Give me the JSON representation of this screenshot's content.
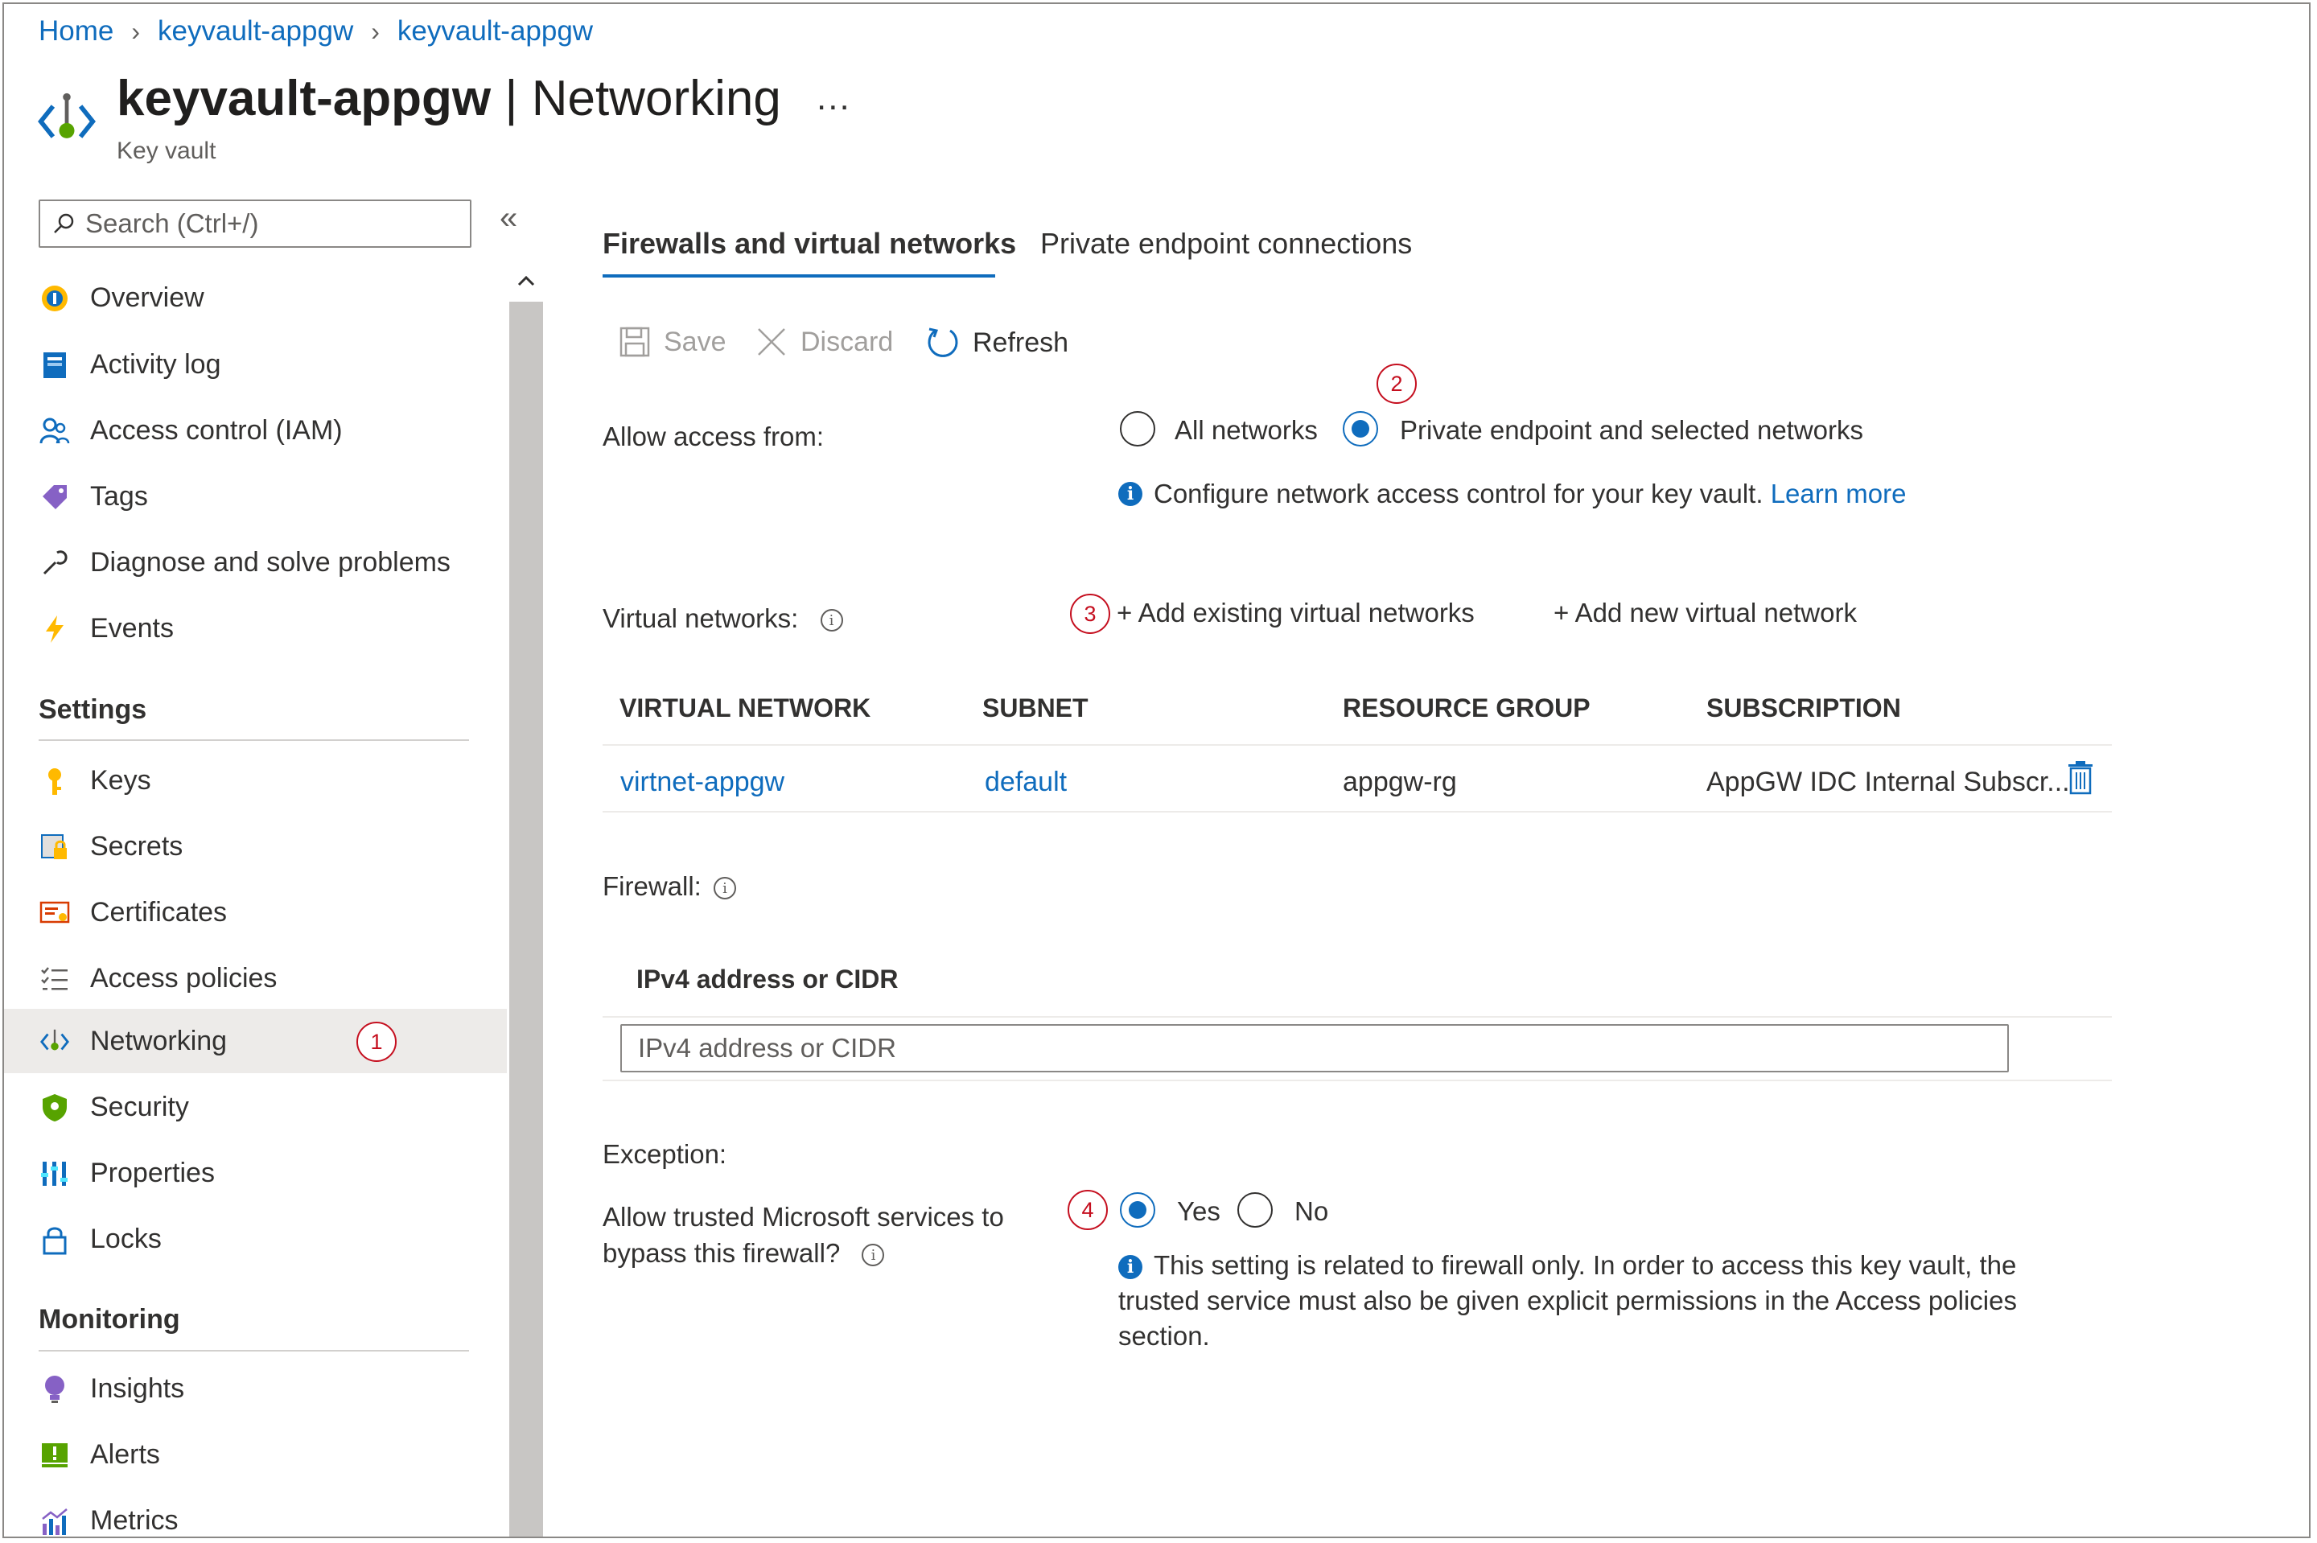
{
  "breadcrumb": {
    "items": [
      "Home",
      "keyvault-appgw",
      "keyvault-appgw"
    ]
  },
  "header": {
    "title_resource": "keyvault-appgw",
    "title_separator": "|",
    "title_page": "Networking",
    "more": "...",
    "subtitle": "Key vault",
    "icon": "networking-icon"
  },
  "sidebar": {
    "search_placeholder": "Search (Ctrl+/)",
    "collapse_label": "«",
    "items": [
      {
        "label": "Overview",
        "icon": "overview-icon"
      },
      {
        "label": "Activity log",
        "icon": "activity-log-icon"
      },
      {
        "label": "Access control (IAM)",
        "icon": "people-icon"
      },
      {
        "label": "Tags",
        "icon": "tag-icon"
      },
      {
        "label": "Diagnose and solve problems",
        "icon": "wrench-icon"
      },
      {
        "label": "Events",
        "icon": "lightning-icon"
      }
    ],
    "settings_title": "Settings",
    "settings_items": [
      {
        "label": "Keys",
        "icon": "key-icon"
      },
      {
        "label": "Secrets",
        "icon": "secret-icon"
      },
      {
        "label": "Certificates",
        "icon": "certificate-icon"
      },
      {
        "label": "Access policies",
        "icon": "checklist-icon"
      },
      {
        "label": "Networking",
        "icon": "networking-icon",
        "active": true
      },
      {
        "label": "Security",
        "icon": "shield-icon"
      },
      {
        "label": "Properties",
        "icon": "properties-icon"
      },
      {
        "label": "Locks",
        "icon": "lock-icon"
      }
    ],
    "monitoring_title": "Monitoring",
    "monitoring_items": [
      {
        "label": "Insights",
        "icon": "lightbulb-icon"
      },
      {
        "label": "Alerts",
        "icon": "alert-icon"
      },
      {
        "label": "Metrics",
        "icon": "metrics-icon"
      }
    ]
  },
  "markers": [
    "1",
    "2",
    "3",
    "4"
  ],
  "tabs": [
    "Firewalls and virtual networks",
    "Private endpoint connections"
  ],
  "toolbar": {
    "save": "Save",
    "discard": "Discard",
    "refresh": "Refresh"
  },
  "access": {
    "label": "Allow access from:",
    "option_all": "All networks",
    "option_private": "Private endpoint and selected networks",
    "selected": "Private endpoint and selected networks",
    "info_text": "Configure network access control for your key vault.",
    "learn_more": "Learn more"
  },
  "vnets": {
    "label": "Virtual networks:",
    "add_existing": "+ Add existing virtual networks",
    "add_new": "+ Add new virtual network",
    "columns": [
      "VIRTUAL NETWORK",
      "SUBNET",
      "RESOURCE GROUP",
      "SUBSCRIPTION"
    ],
    "rows": [
      {
        "network": "virtnet-appgw",
        "subnet": "default",
        "resource_group": "appgw-rg",
        "subscription": "AppGW IDC Internal Subscr..."
      }
    ]
  },
  "firewall": {
    "label": "Firewall:",
    "column": "IPv4 address or CIDR",
    "placeholder": "IPv4 address or CIDR"
  },
  "exception": {
    "label": "Exception:",
    "question_line1": "Allow trusted Microsoft services to",
    "question_line2": "bypass this firewall?",
    "yes": "Yes",
    "no": "No",
    "selected": "Yes",
    "info_line1": "This setting is related to firewall only. In order to access this key vault, the",
    "info_line2": "trusted service must also be given explicit permissions in the Access policies",
    "info_line3": "section."
  },
  "colors": {
    "accent": "#0f6cbd",
    "marker": "#c50f1f",
    "active_nav": "#edebe9"
  }
}
